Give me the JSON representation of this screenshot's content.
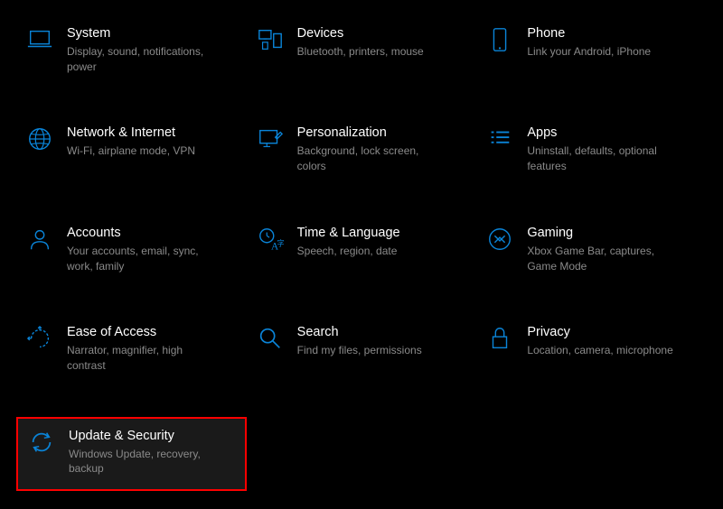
{
  "tiles": [
    {
      "id": "system",
      "title": "System",
      "subtitle": "Display, sound, notifications, power",
      "icon": "laptop-icon",
      "highlighted": false
    },
    {
      "id": "devices",
      "title": "Devices",
      "subtitle": "Bluetooth, printers, mouse",
      "icon": "devices-icon",
      "highlighted": false
    },
    {
      "id": "phone",
      "title": "Phone",
      "subtitle": "Link your Android, iPhone",
      "icon": "phone-icon",
      "highlighted": false
    },
    {
      "id": "network",
      "title": "Network & Internet",
      "subtitle": "Wi-Fi, airplane mode, VPN",
      "icon": "globe-icon",
      "highlighted": false
    },
    {
      "id": "personalization",
      "title": "Personalization",
      "subtitle": "Background, lock screen, colors",
      "icon": "personalization-icon",
      "highlighted": false
    },
    {
      "id": "apps",
      "title": "Apps",
      "subtitle": "Uninstall, defaults, optional features",
      "icon": "apps-icon",
      "highlighted": false
    },
    {
      "id": "accounts",
      "title": "Accounts",
      "subtitle": "Your accounts, email, sync, work, family",
      "icon": "accounts-icon",
      "highlighted": false
    },
    {
      "id": "time",
      "title": "Time & Language",
      "subtitle": "Speech, region, date",
      "icon": "time-language-icon",
      "highlighted": false
    },
    {
      "id": "gaming",
      "title": "Gaming",
      "subtitle": "Xbox Game Bar, captures, Game Mode",
      "icon": "gaming-icon",
      "highlighted": false
    },
    {
      "id": "ease",
      "title": "Ease of Access",
      "subtitle": "Narrator, magnifier, high contrast",
      "icon": "ease-access-icon",
      "highlighted": false
    },
    {
      "id": "search",
      "title": "Search",
      "subtitle": "Find my files, permissions",
      "icon": "search-icon",
      "highlighted": false
    },
    {
      "id": "privacy",
      "title": "Privacy",
      "subtitle": "Location, camera, microphone",
      "icon": "lock-icon",
      "highlighted": false
    },
    {
      "id": "update",
      "title": "Update & Security",
      "subtitle": "Windows Update, recovery, backup",
      "icon": "update-icon",
      "highlighted": true
    }
  ],
  "accent_color": "#0078d4"
}
